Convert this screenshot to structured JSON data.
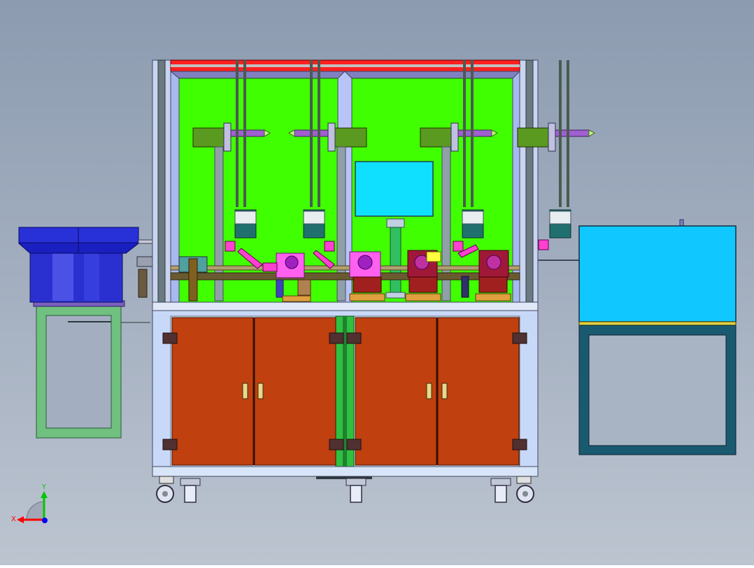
{
  "view": {
    "background_top": "#8c9bb0",
    "background_bottom": "#bcc4d0"
  },
  "axis_triad": {
    "x_label": "X",
    "y_label": "Y",
    "x_color": "#ff0000",
    "y_color": "#00c800",
    "z_color": "#0000ff"
  },
  "colors": {
    "back_panel": "#40ff00",
    "cabinet_door": "#c0400f",
    "frame": "#b8c8e8",
    "control_box": "#10c8ff",
    "bowl_feeder": "#1a20c0",
    "top_rail": "#ff2020",
    "column": "#5a7070",
    "stand_frame": "#70c080",
    "cabinet_stand": "#1a5a70"
  },
  "components": [
    {
      "name": "vibratory-bowl-feeder",
      "icon": "bowl-feeder-icon"
    },
    {
      "name": "feeder-stand",
      "icon": "frame-stand-icon"
    },
    {
      "name": "main-machine-frame",
      "icon": "machine-frame-icon"
    },
    {
      "name": "work-stations",
      "count": 4,
      "icon": "station-icon"
    },
    {
      "name": "cylinder-actuators",
      "count": 4,
      "icon": "cylinder-icon"
    },
    {
      "name": "lower-cabinet-doors",
      "count": 4,
      "icon": "door-icon"
    },
    {
      "name": "electrical-control-box",
      "icon": "control-box-icon"
    },
    {
      "name": "casters",
      "count": 4,
      "icon": "caster-icon"
    }
  ]
}
